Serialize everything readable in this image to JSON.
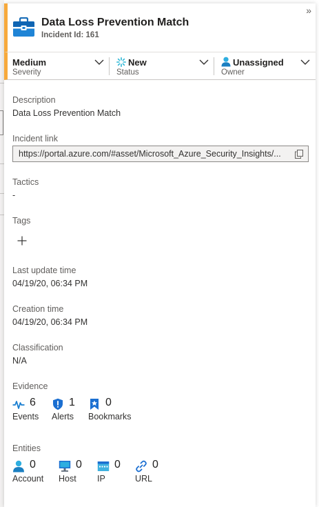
{
  "header": {
    "title": "Data Loss Prevention Match",
    "subtitle": "Incident Id: 161",
    "collapse_glyph": "»",
    "icon": "briefcase-icon",
    "accent_color": "#f7a93b"
  },
  "meta": {
    "severity": {
      "value": "Medium",
      "label": "Severity"
    },
    "status": {
      "value": "New",
      "label": "Status",
      "icon": "spinner-icon"
    },
    "owner": {
      "value": "Unassigned",
      "label": "Owner",
      "icon": "person-icon"
    }
  },
  "details": {
    "description_label": "Description",
    "description_value": "Data Loss Prevention Match",
    "incident_link_label": "Incident link",
    "incident_link_value": "https://portal.azure.com/#asset/Microsoft_Azure_Security_Insights/...",
    "tactics_label": "Tactics",
    "tactics_value": "-",
    "tags_label": "Tags",
    "last_update_label": "Last update time",
    "last_update_value": "04/19/20, 06:34 PM",
    "creation_label": "Creation time",
    "creation_value": "04/19/20, 06:34 PM",
    "classification_label": "Classification",
    "classification_value": "N/A"
  },
  "evidence": {
    "label": "Evidence",
    "items": [
      {
        "count": "6",
        "label": "Events",
        "icon": "pulse-icon"
      },
      {
        "count": "1",
        "label": "Alerts",
        "icon": "shield-icon"
      },
      {
        "count": "0",
        "label": "Bookmarks",
        "icon": "bookmark-icon"
      }
    ]
  },
  "entities": {
    "label": "Entities",
    "items": [
      {
        "count": "0",
        "label": "Account",
        "icon": "account-icon"
      },
      {
        "count": "0",
        "label": "Host",
        "icon": "host-icon"
      },
      {
        "count": "0",
        "label": "IP",
        "icon": "ip-icon"
      },
      {
        "count": "0",
        "label": "URL",
        "icon": "link-icon"
      }
    ]
  }
}
